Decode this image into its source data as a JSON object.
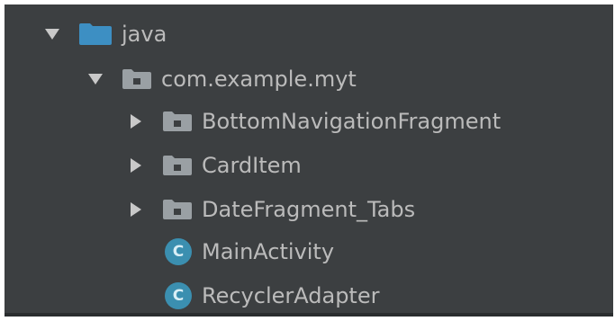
{
  "colors": {
    "panel_bg": "#3c3f41",
    "text": "#bbbbbb",
    "arrow": "#c9c9c9",
    "source_folder": "#3d8fc3",
    "package_folder": "#9aa0a4",
    "class_badge": "#3b8fb0",
    "class_letter": "#d8eef6"
  },
  "tree": {
    "java": {
      "label": "java",
      "expanded": true,
      "icon": "source-folder-icon"
    },
    "package": {
      "label": "com.example.myt",
      "expanded": true,
      "icon": "package-folder-icon"
    },
    "children": [
      {
        "label": "BottomNavigationFragment",
        "kind": "package",
        "expanded": false,
        "icon": "package-folder-icon"
      },
      {
        "label": "CardItem",
        "kind": "package",
        "expanded": false,
        "icon": "package-folder-icon"
      },
      {
        "label": "DateFragment_Tabs",
        "kind": "package",
        "expanded": false,
        "icon": "package-folder-icon"
      },
      {
        "label": "MainActivity",
        "kind": "class",
        "icon": "class-icon",
        "badge_letter": "C"
      },
      {
        "label": "RecyclerAdapter",
        "kind": "class",
        "icon": "class-icon",
        "badge_letter": "C"
      }
    ]
  }
}
